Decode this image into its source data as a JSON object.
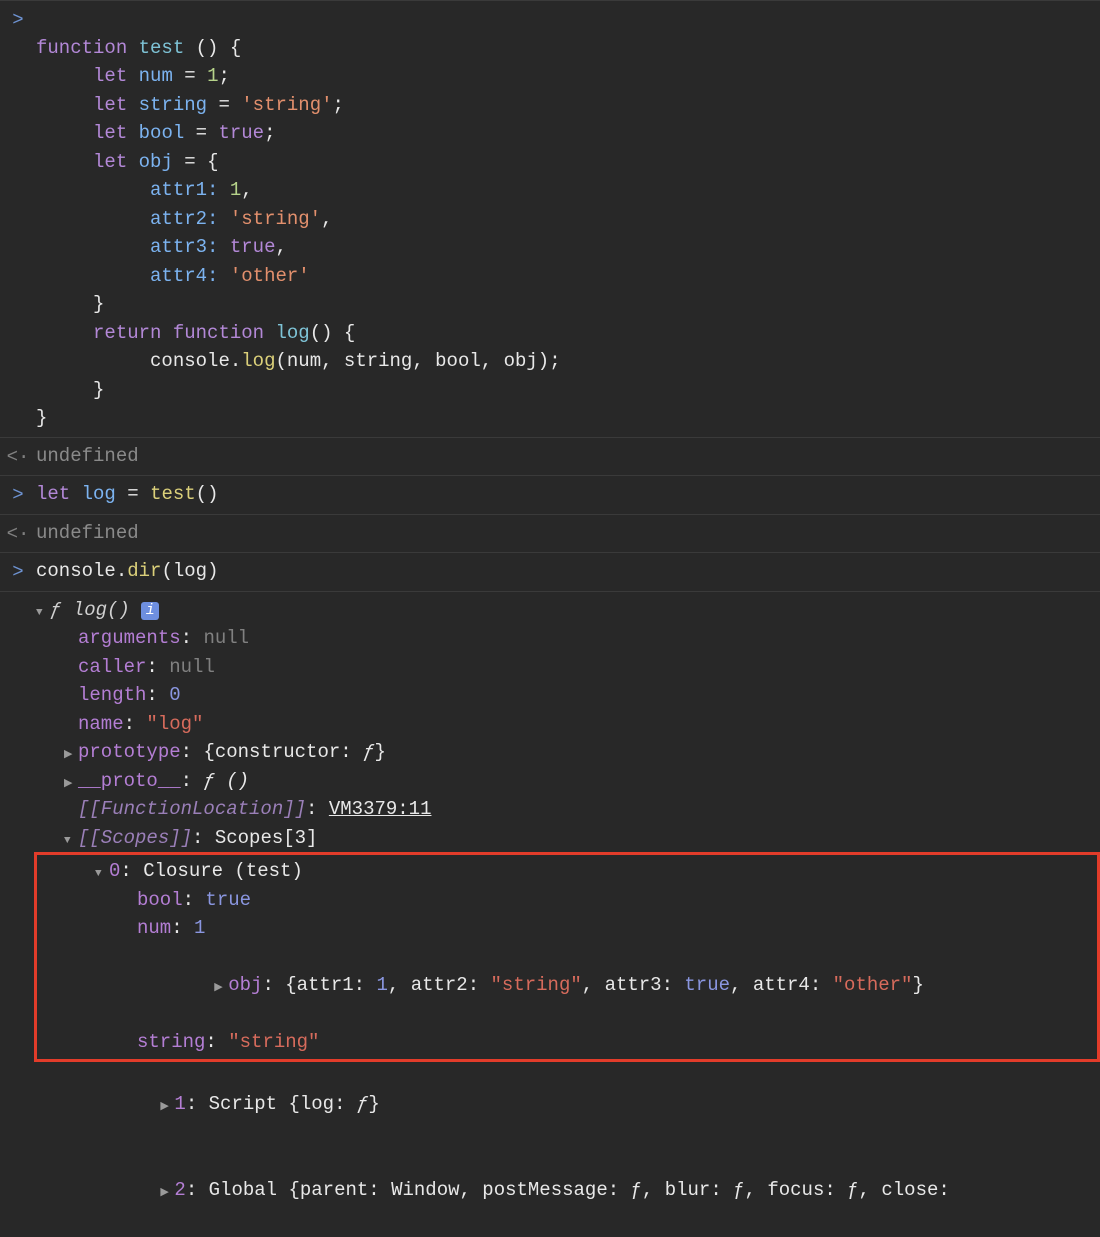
{
  "gutters": {
    "input": ">",
    "output": "<·"
  },
  "code": {
    "t1": "function",
    "t2": "test",
    "t3": "()",
    "t4": "{",
    "t5": "let",
    "t6": "num",
    "t7": "=",
    "t8": "1",
    "t9": ";",
    "t10": "let",
    "t11": "string",
    "t12": "=",
    "t13": "'string'",
    "t14": ";",
    "t15": "let",
    "t16": "bool",
    "t17": "=",
    "t18": "true",
    "t19": ";",
    "t20": "let",
    "t21": "obj",
    "t22": "= {",
    "t23": "attr1:",
    "t24": "1",
    "t25": ",",
    "t26": "attr2:",
    "t27": "'string'",
    "t28": ",",
    "t29": "attr3:",
    "t30": "true",
    "t31": ",",
    "t32": "attr4:",
    "t33": "'other'",
    "t34": "}",
    "t35": "return",
    "t36": "function",
    "t37": "log",
    "t38": "()",
    "t39": "{",
    "t40": "console",
    "t41": ".",
    "t42": "log",
    "t43": "(",
    "t44": "num",
    "t45": ",",
    "t46": "string",
    "t47": ",",
    "t48": "bool",
    "t49": ",",
    "t50": "obj",
    "t51": ");",
    "t52": "}",
    "t53": "}"
  },
  "result1": "undefined",
  "line2": {
    "t1": "let",
    "t2": "log",
    "t3": "=",
    "t4": "test",
    "t5": "()"
  },
  "result2": "undefined",
  "line3": {
    "t1": "console",
    "t2": ".",
    "t3": "dir",
    "t4": "(",
    "t5": "log",
    "t6": ")"
  },
  "dir": {
    "header": {
      "f": "ƒ",
      "sig": "log()",
      "info": "i"
    },
    "arguments": {
      "k": "arguments",
      "v": "null"
    },
    "caller": {
      "k": "caller",
      "v": "null"
    },
    "length": {
      "k": "length",
      "v": "0"
    },
    "name": {
      "k": "name",
      "v": "\"log\""
    },
    "prototype": {
      "k": "prototype",
      "v1": "{constructor: ",
      "f": "ƒ",
      "v2": "}"
    },
    "proto": {
      "k": "__proto__",
      "f": "ƒ",
      "paren": "()"
    },
    "funcloc": {
      "k": "[[FunctionLocation]]",
      "v": "VM3379:11"
    },
    "scopes": {
      "k": "[[Scopes]]",
      "v": "Scopes[3]"
    },
    "closure": {
      "head": {
        "idx": "0",
        "label": "Closure (test)"
      },
      "bool": {
        "k": "bool",
        "v": "true"
      },
      "num": {
        "k": "num",
        "v": "1"
      },
      "obj": {
        "k": "obj",
        "open": "{",
        "a1k": "attr1",
        "a1v": "1",
        "c1": ", ",
        "a2k": "attr2",
        "a2v": "\"string\"",
        "c2": ", ",
        "a3k": "attr3",
        "a3v": "true",
        "c3": ", ",
        "a4k": "attr4",
        "a4v": "\"other\"",
        "close": "}"
      },
      "string": {
        "k": "string",
        "v": "\"string\""
      }
    },
    "scope1": {
      "idx": "1",
      "label": "Script ",
      "open": "{",
      "k": "log",
      "f": "ƒ",
      "close": "}"
    },
    "scope2": {
      "idx": "2",
      "label": "Global ",
      "inner": "{parent: Window, postMessage: ƒ, blur: ƒ, focus: ƒ, close:"
    }
  }
}
